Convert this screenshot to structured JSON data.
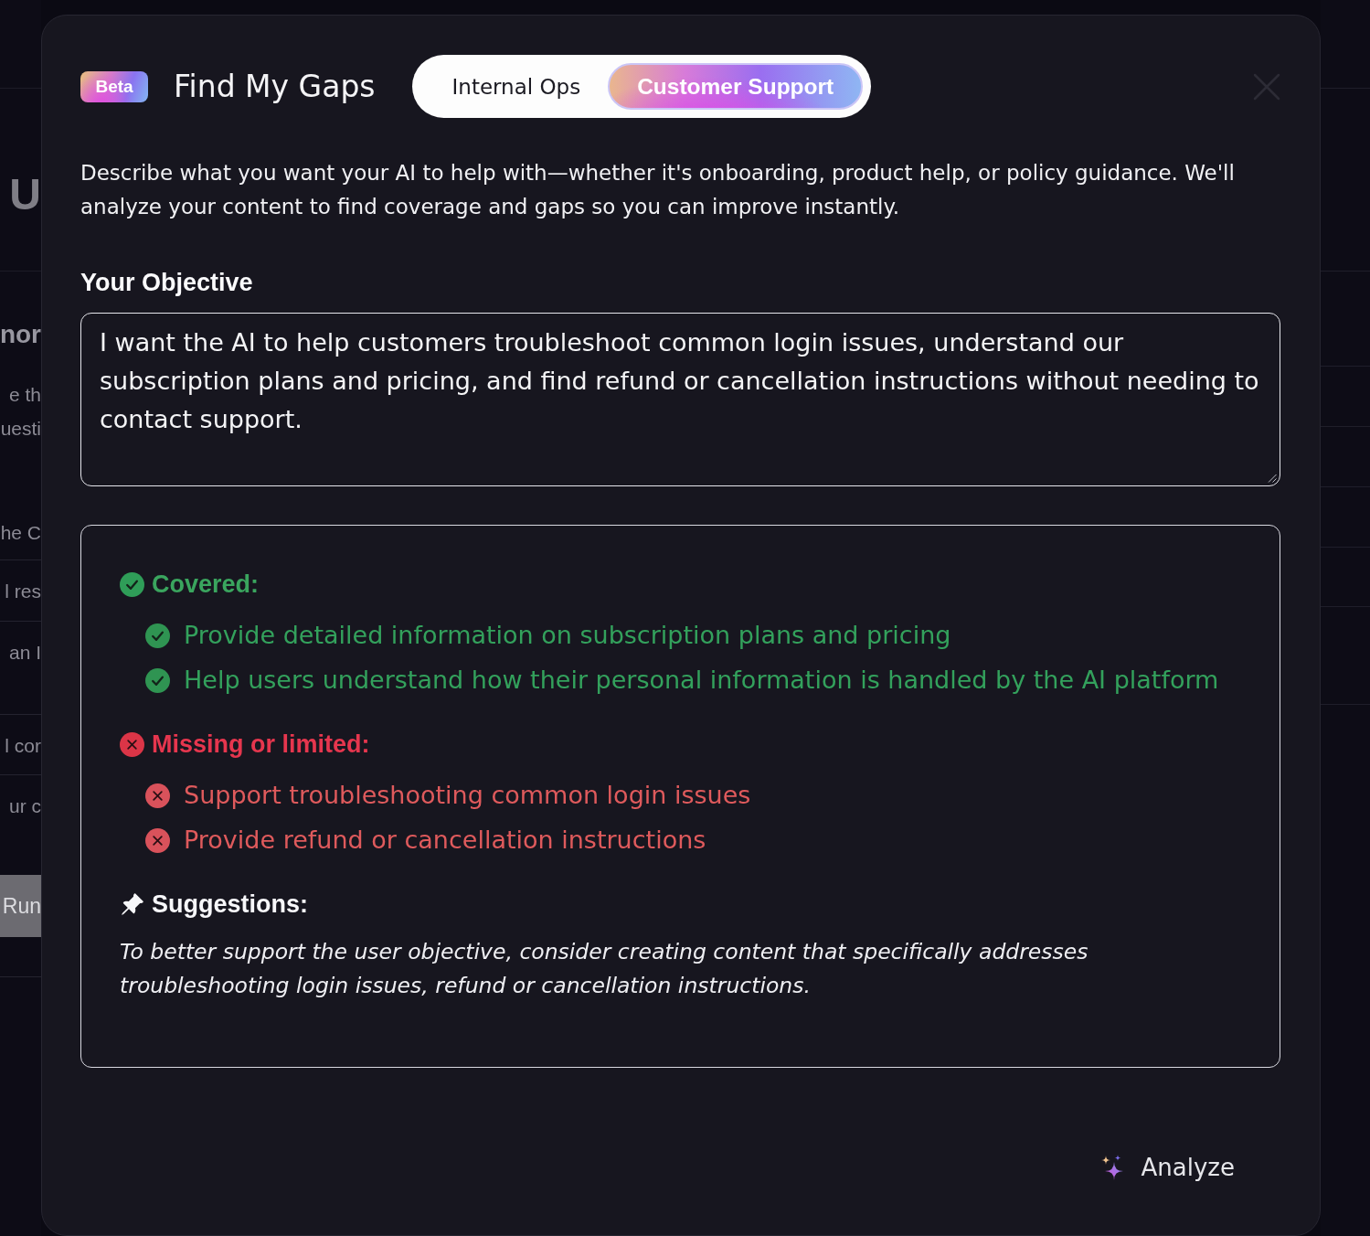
{
  "background_page": {
    "hero_fragment": "U",
    "rows": [
      {
        "lines": [
          {
            "text": "nor",
            "kind": "heading"
          },
          {
            "text": "e th",
            "kind": "text"
          },
          {
            "text": "uesti",
            "kind": "text"
          },
          {
            "text": "he C",
            "kind": "text"
          }
        ]
      },
      {
        "lines": [
          {
            "text": "l res",
            "kind": "text"
          }
        ]
      },
      {
        "lines": [
          {
            "text": "an I",
            "kind": "text"
          }
        ]
      },
      {
        "lines": [
          {
            "text": "l cor",
            "kind": "text"
          }
        ]
      },
      {
        "lines": [
          {
            "text": "ur c",
            "kind": "text"
          },
          {
            "text": "Run",
            "kind": "button"
          }
        ]
      }
    ]
  },
  "dialog": {
    "badge": "Beta",
    "title": "Find My Gaps",
    "tabs": [
      {
        "label": "Internal Ops",
        "selected": false
      },
      {
        "label": "Customer Support",
        "selected": true
      }
    ],
    "description": "Describe what you want your AI to help with—whether it's onboarding, product help, or policy guidance. We'll analyze your content to find coverage and gaps so you can improve instantly.",
    "objective": {
      "label": "Your Objective",
      "value": "I want the AI to help customers troubleshoot common login issues, understand our subscription plans and pricing, and find refund or cancellation instructions without needing to contact support."
    },
    "results": [
      {
        "kind": "covered",
        "heading": "Covered:",
        "items": [
          "Provide detailed information on subscription plans and pricing",
          "Help users understand how their personal information is handled by the AI platform"
        ]
      },
      {
        "kind": "missing",
        "heading": "Missing or limited:",
        "items": [
          "Support troubleshooting common login issues",
          "Provide refund or cancellation instructions"
        ]
      },
      {
        "kind": "suggestions",
        "heading": "Suggestions:",
        "text": "To better support the user objective, consider creating content that specifically addresses troubleshooting login issues, refund or cancellation instructions."
      }
    ],
    "analyze_button": "Analyze"
  }
}
